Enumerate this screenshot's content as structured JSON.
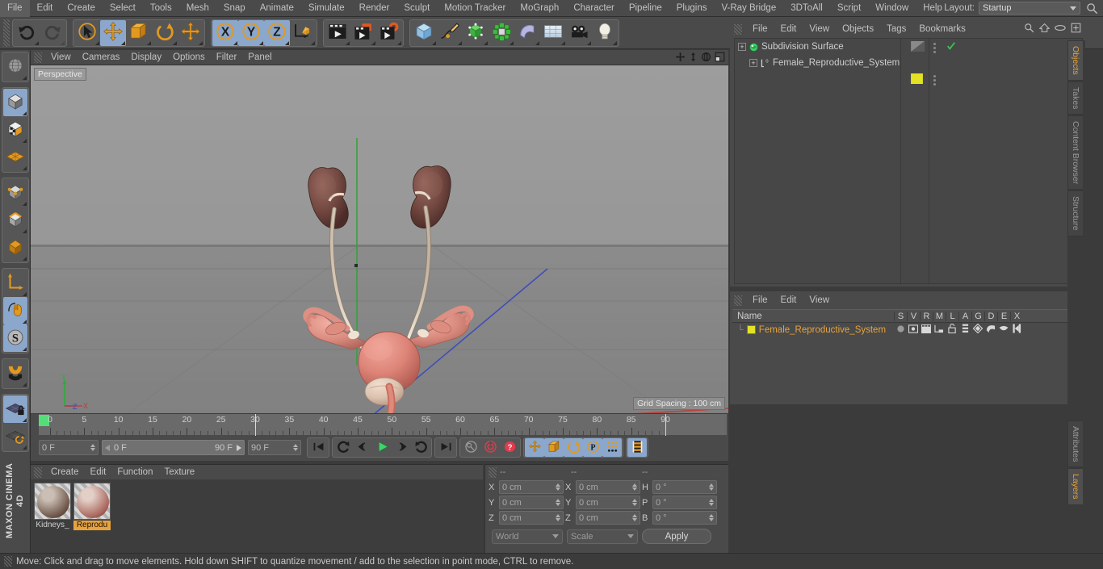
{
  "app": {
    "brand": "MAXON CINEMA 4D"
  },
  "menubar": {
    "items": [
      "File",
      "Edit",
      "Create",
      "Select",
      "Tools",
      "Mesh",
      "Snap",
      "Animate",
      "Simulate",
      "Render",
      "Sculpt",
      "Motion Tracker",
      "MoGraph",
      "Character",
      "Pipeline",
      "Plugins",
      "V-Ray Bridge",
      "3DToAll",
      "Script",
      "Window",
      "Help"
    ],
    "layout_label": "Layout:",
    "layout_value": "Startup",
    "search_icon": "search-icon"
  },
  "toolbar": {
    "groups": [
      {
        "name": "undo-redo",
        "buttons": [
          {
            "name": "undo-button",
            "icon": "undo-icon",
            "active": false,
            "disabled": false
          },
          {
            "name": "redo-button",
            "icon": "redo-icon",
            "active": false,
            "disabled": true
          }
        ]
      },
      {
        "name": "transform-tools",
        "buttons": [
          {
            "name": "select-tool",
            "icon": "cursor-select-icon",
            "active": false,
            "disabled": false
          },
          {
            "name": "move-tool",
            "icon": "move-icon",
            "active": true,
            "disabled": false
          },
          {
            "name": "scale-tool",
            "icon": "scale-icon",
            "active": false,
            "disabled": false
          },
          {
            "name": "rotate-tool",
            "icon": "rotate-icon",
            "active": false,
            "disabled": false
          },
          {
            "name": "axis-move-tool",
            "icon": "move-axis-icon",
            "active": false,
            "disabled": false
          }
        ]
      },
      {
        "name": "axis-locks",
        "buttons": [
          {
            "name": "lock-x-axis",
            "icon": "x-axis-icon",
            "active": true,
            "disabled": false
          },
          {
            "name": "lock-y-axis",
            "icon": "y-axis-icon",
            "active": true,
            "disabled": false
          },
          {
            "name": "lock-z-axis",
            "icon": "z-axis-icon",
            "active": true,
            "disabled": false
          },
          {
            "name": "world-coordinate-toggle",
            "icon": "world-axis-cube-icon",
            "active": false,
            "disabled": false
          }
        ]
      },
      {
        "name": "render-tools",
        "buttons": [
          {
            "name": "render-view-button",
            "icon": "render-view-icon",
            "active": false,
            "disabled": false
          },
          {
            "name": "render-to-picture-viewer-button",
            "icon": "render-picture-icon",
            "active": false,
            "disabled": false
          },
          {
            "name": "render-settings-button",
            "icon": "render-settings-icon",
            "active": false,
            "disabled": false
          }
        ]
      },
      {
        "name": "create-objects",
        "buttons": [
          {
            "name": "add-cube-button",
            "icon": "cube-icon",
            "active": false,
            "disabled": false
          },
          {
            "name": "add-spline-button",
            "icon": "pen-spline-icon",
            "active": false,
            "disabled": false
          },
          {
            "name": "add-generator-button",
            "icon": "generator-cube-icon",
            "active": false,
            "disabled": false
          },
          {
            "name": "add-mograph-button",
            "icon": "mograph-cluster-icon",
            "active": false,
            "disabled": false
          },
          {
            "name": "add-deformer-button",
            "icon": "bend-deformer-icon",
            "active": false,
            "disabled": false
          },
          {
            "name": "add-scene-object-button",
            "icon": "floor-grid-icon",
            "active": false,
            "disabled": false
          },
          {
            "name": "add-camera-button",
            "icon": "camera-icon",
            "active": false,
            "disabled": false
          },
          {
            "name": "add-light-button",
            "icon": "light-bulb-icon",
            "active": false,
            "disabled": false
          }
        ]
      }
    ]
  },
  "left_toolbar": {
    "groups": [
      {
        "name": "g1",
        "buttons": [
          {
            "name": "make-editable-button",
            "icon": "globe-editable-icon",
            "active": false
          }
        ]
      },
      {
        "name": "g2",
        "buttons": [
          {
            "name": "model-mode-button",
            "icon": "model-cube-icon",
            "active": true
          },
          {
            "name": "texture-mode-button",
            "icon": "texture-cube-icon",
            "active": false
          },
          {
            "name": "workplane-mode-button",
            "icon": "workplane-icon",
            "active": false
          }
        ]
      },
      {
        "name": "g3",
        "buttons": [
          {
            "name": "point-mode-button",
            "icon": "point-mode-icon",
            "active": false
          },
          {
            "name": "edge-mode-button",
            "icon": "edge-mode-icon",
            "active": false
          },
          {
            "name": "polygon-mode-button",
            "icon": "polygon-mode-icon",
            "active": false
          }
        ]
      },
      {
        "name": "g4",
        "buttons": [
          {
            "name": "axis-mode-button",
            "icon": "axis-l-icon",
            "active": false
          },
          {
            "name": "viewport-solo-button",
            "icon": "mouse-icon",
            "active": true
          },
          {
            "name": "snap-s-button",
            "icon": "s-circle-icon",
            "active": true
          }
        ]
      },
      {
        "name": "g5",
        "buttons": [
          {
            "name": "magnet-tool-button",
            "icon": "magnet-icon",
            "active": false
          }
        ]
      },
      {
        "name": "g6",
        "buttons": [
          {
            "name": "workplane-lock-button",
            "icon": "grid-lock-icon",
            "active": true
          },
          {
            "name": "workplane-rotate-button",
            "icon": "grid-rotate-icon",
            "active": false
          }
        ]
      }
    ]
  },
  "viewport": {
    "menu": [
      "View",
      "Cameras",
      "Display",
      "Options",
      "Filter",
      "Panel"
    ],
    "label": "Perspective",
    "grid_spacing": "Grid Spacing : 100 cm",
    "nav_icons": [
      "pan-icon",
      "dolly-icon",
      "rotate-view-icon",
      "maximize-view-icon"
    ],
    "axis_gizmo": {
      "y": "Y",
      "z": "Z",
      "x": "X"
    },
    "scene_description": "Female reproductive system with kidneys 3D model"
  },
  "timeline": {
    "ticks": [
      0,
      5,
      10,
      15,
      20,
      25,
      30,
      35,
      40,
      45,
      50,
      55,
      60,
      65,
      70,
      75,
      80,
      85,
      90
    ],
    "current_frame": "0 F",
    "range_start": "0 F",
    "range_end": "90 F",
    "end_frame": "90 F",
    "preview_frame": "0 F",
    "transport": [
      {
        "name": "go-to-start-button",
        "icon": "skip-start-icon",
        "active": false
      },
      {
        "name": "play-reverse-loop-button",
        "icon": "loop-reverse-icon",
        "active": false
      },
      {
        "name": "step-back-button",
        "icon": "step-back-icon",
        "active": false
      },
      {
        "name": "play-button",
        "icon": "play-icon",
        "active": false
      },
      {
        "name": "step-forward-button",
        "icon": "step-forward-icon",
        "active": false
      },
      {
        "name": "play-loop-button",
        "icon": "loop-forward-icon",
        "active": false
      },
      {
        "name": "go-to-end-button",
        "icon": "skip-end-icon",
        "active": false
      }
    ],
    "keyframe_tools": [
      {
        "name": "record-active-objects-button",
        "icon": "key-icon",
        "active": false
      },
      {
        "name": "autokeying-button",
        "icon": "autokey-icon",
        "active": false
      },
      {
        "name": "keyframe-selection-button",
        "icon": "question-key-icon",
        "active": false
      }
    ],
    "key_toggles": [
      {
        "name": "key-position-button",
        "icon": "position-key-icon",
        "active": true
      },
      {
        "name": "key-scale-button",
        "icon": "scale-key-icon",
        "active": true
      },
      {
        "name": "key-rotation-button",
        "icon": "rotation-key-icon",
        "active": true
      },
      {
        "name": "key-parameter-button",
        "icon": "parameter-key-icon",
        "active": true
      },
      {
        "name": "key-pla-button",
        "icon": "pla-dots-icon",
        "active": true
      }
    ],
    "timeline_toggle": {
      "name": "timeline-view-button",
      "icon": "timeline-strip-icon",
      "active": true
    }
  },
  "materials": {
    "menu": [
      "Create",
      "Edit",
      "Function",
      "Texture"
    ],
    "items": [
      {
        "name": "Kidneys_",
        "selected": false,
        "color1": "#cbbfb5",
        "color2": "#6b5245"
      },
      {
        "name": "Reprodu",
        "selected": true,
        "color1": "#e2cfc6",
        "color2": "#a8635a"
      }
    ]
  },
  "coordinates": {
    "headers": [
      "--",
      "--",
      "--"
    ],
    "rows": [
      {
        "labels": [
          "X",
          "X",
          "H"
        ],
        "values": [
          "0 cm",
          "0 cm",
          "0 °"
        ]
      },
      {
        "labels": [
          "Y",
          "Y",
          "P"
        ],
        "values": [
          "0 cm",
          "0 cm",
          "0 °"
        ]
      },
      {
        "labels": [
          "Z",
          "Z",
          "B"
        ],
        "values": [
          "0 cm",
          "0 cm",
          "0 °"
        ]
      }
    ],
    "system_dropdown": "World",
    "mode_dropdown": "Scale",
    "apply_button": "Apply"
  },
  "object_manager": {
    "menu": [
      "File",
      "Edit",
      "View",
      "Objects",
      "Tags",
      "Bookmarks"
    ],
    "icons": [
      "search-icon",
      "home-icon",
      "eye-icon",
      "plus-box-icon"
    ],
    "rows": [
      {
        "name": "Subdivision Surface",
        "indent": 0,
        "icon": "subdivision-surface-icon",
        "tag": "half-disc-tag",
        "check": true,
        "selected": false
      },
      {
        "name": "Female_Reproductive_System",
        "indent": 1,
        "icon": "null-object-icon",
        "tag": "yellow-layer-tag",
        "check": false,
        "selected": false
      }
    ]
  },
  "layer_manager": {
    "menu": [
      "File",
      "Edit",
      "View"
    ],
    "columns": [
      "Name",
      "S",
      "V",
      "R",
      "M",
      "L",
      "A",
      "G",
      "D",
      "E",
      "X"
    ],
    "rows": [
      {
        "name": "Female_Reproductive_System",
        "color": "#e2e224",
        "cells": [
          "dot-icon",
          "view-icon",
          "render-icon",
          "manager-icon",
          "lock-open-icon",
          "animation-icon",
          "generator-icon",
          "deformer-icon",
          "expression-icon",
          "xpresso-icon"
        ]
      }
    ]
  },
  "right_tabs_upper": [
    {
      "label": "Objects",
      "active": true
    },
    {
      "label": "Takes",
      "active": false
    },
    {
      "label": "Content Browser",
      "active": false
    },
    {
      "label": "Structure",
      "active": false
    }
  ],
  "right_tabs_lower": [
    {
      "label": "Attributes",
      "active": false
    },
    {
      "label": "Layers",
      "active": true
    }
  ],
  "statusbar": {
    "text": "Move: Click and drag to move elements. Hold down SHIFT to quantize movement / add to the selection in point mode, CTRL to remove."
  },
  "colors": {
    "accent_orange": "#e8a33d",
    "active_blue": "#8ba7cc",
    "panel_bg": "#4a4a4a",
    "viewport_top": "#969696",
    "viewport_floor": "#8a8a8a"
  }
}
